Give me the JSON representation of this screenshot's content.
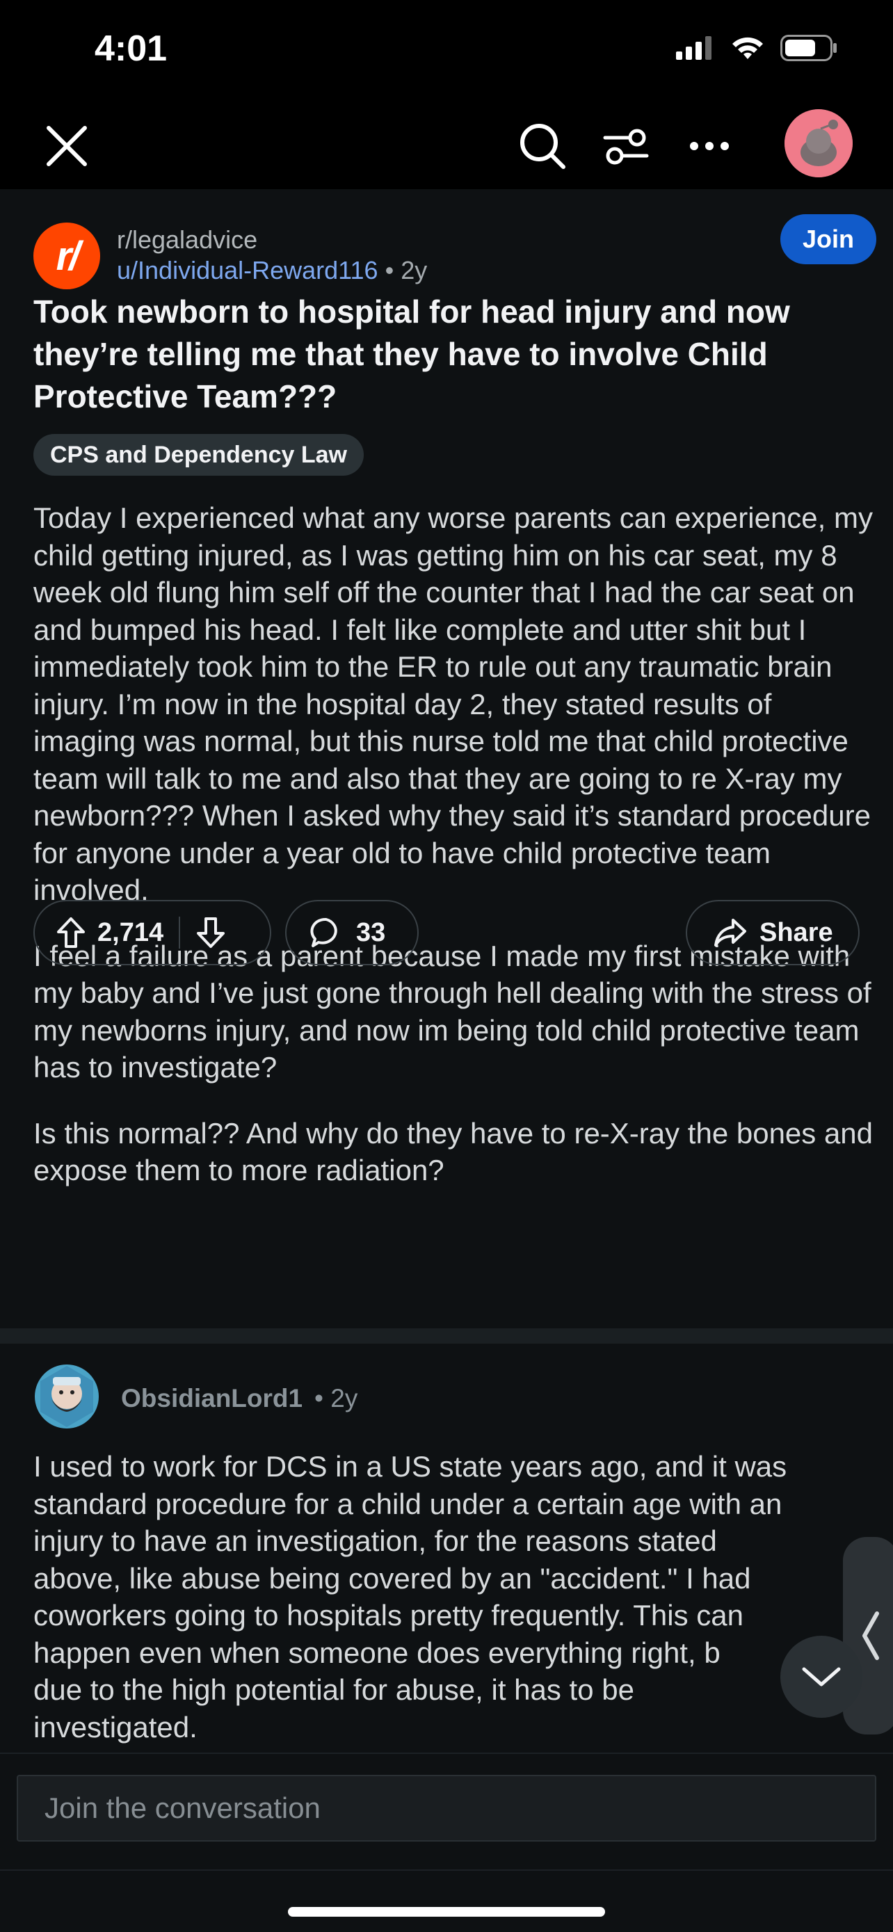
{
  "status_bar": {
    "time": "4:01",
    "icons": [
      "cellular-signal-icon",
      "wifi-icon",
      "battery-icon"
    ],
    "battery_level": 0.7
  },
  "top_bar": {
    "icons": [
      "close-icon",
      "search-icon",
      "sort-filter-icon",
      "more-icon",
      "user-avatar"
    ]
  },
  "post": {
    "subreddit": "r/legaladvice",
    "subreddit_icon_text": "r/",
    "author": "u/Individual-Reward116",
    "separator": "•",
    "age": "2y",
    "join_label": "Join",
    "title": "Took newborn to hospital for head injury and now they’re telling me that they have to involve Child Protective Team???",
    "flair": "CPS and Dependency Law",
    "paragraphs": [
      "Today I experienced what any worse parents can experience, my child getting injured, as I was getting him on his car seat, my 8 week old flung him self off the counter that I had the car seat on and bumped his head. I felt like complete and utter shit but I immediately took him to the ER to rule out any traumatic brain injury. I’m now in the hospital day 2, they stated results of imaging was normal, but this nurse told me that child protective team will talk to me and also that they are going to re X-ray my newborn??? When I asked why they said it’s standard procedure for anyone under a year old to have child protective team involved.",
      "I feel a failure as a parent because I made my first mistake with my baby and I’ve just gone through hell dealing with the stress of my newborns injury, and now im being told child protective team has to investigate?",
      "Is this normal?? And why do they have to re-X-ray the bones and expose them to more radiation?"
    ],
    "votes": "2,714",
    "comments": "33",
    "share_label": "Share"
  },
  "comment": {
    "author": "ObsidianLord1",
    "separator": "•",
    "age": "2y",
    "lines": [
      "I used to work for DCS in a US state years ago, and it was",
      "standard procedure for a child under a certain age with an",
      "injury to have an investigation, for the reasons stated",
      "above, like abuse being covered by an \"accident.\" I had",
      "coworkers going to hospitals pretty frequently. This can",
      "happen even when someone does everything right, b",
      "due to the high potential for abuse, it has to be",
      "investigated."
    ]
  },
  "reply": {
    "placeholder": "Join the conversation"
  },
  "colors": {
    "accent": "#115bca",
    "reddit_orange": "#ff4500",
    "username_blue": "#7ea8ef",
    "background": "#0e1113"
  }
}
